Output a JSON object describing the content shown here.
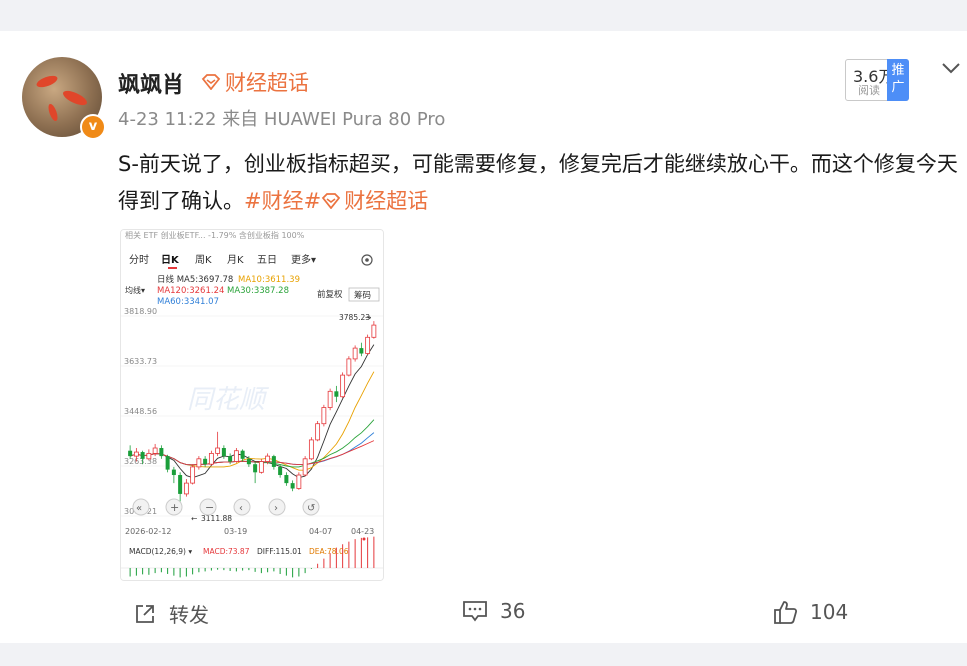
{
  "post": {
    "username": "飒飒肖",
    "topic_tag": "财经超话",
    "time": "4-23 11:22",
    "source": "来自 HUAWEI Pura 80 Pro",
    "reads_count": "3.6万",
    "reads_label": "阅读",
    "promote_label": "推广",
    "text": "S-前天说了，创业板指标超买，可能需要修复，修复完后才能继续放心干。而这个修复今天得到了确认。",
    "hashtag_1": "#财经#",
    "hashtag_2": "财经超话"
  },
  "chart": {
    "topbar": "相关 ETF  创业板ETF...  -1.79%  含创业板指 100%",
    "tabs": [
      "分时",
      "日K",
      "周K",
      "月K",
      "五日",
      "更多▾"
    ],
    "ma_line1_a": "日线 MA5:3697.78",
    "ma_line1_b": "MA10:3611.39",
    "ma_line2_a": "MA120:3261.24",
    "ma_line2_b": "MA30:3387.28",
    "ma_line3": "MA60:3341.07",
    "avg_label": "均线▾",
    "fq_label": "前复权",
    "chip_label": "筹码",
    "y_ticks": [
      "3818.90",
      "3633.73",
      "3448.56",
      "3263.38",
      "3078.21"
    ],
    "last_price": "3785.23",
    "low_price": "3111.88",
    "x_ticks": [
      "2026-02-12",
      "03-19",
      "04-07",
      "04-23"
    ],
    "macd_label": "MACD(12,26,9) ▾",
    "macd_value": "MACD:73.87",
    "diff_value": "DIFF:115.01",
    "dea_value": "DEA:78.06",
    "watermark": "同花顺"
  },
  "chart_data": {
    "type": "candlestick",
    "title": "",
    "xlabel": "",
    "ylabel": "",
    "ylim": [
      3078.21,
      3818.9
    ],
    "candles": [
      [
        3320,
        3300,
        3340,
        3290
      ],
      [
        3300,
        3315,
        3330,
        3280
      ],
      [
        3315,
        3290,
        3320,
        3270
      ],
      [
        3290,
        3310,
        3325,
        3285
      ],
      [
        3310,
        3330,
        3345,
        3300
      ],
      [
        3330,
        3300,
        3340,
        3290
      ],
      [
        3300,
        3250,
        3305,
        3240
      ],
      [
        3250,
        3230,
        3260,
        3200
      ],
      [
        3230,
        3160,
        3240,
        3111.88
      ],
      [
        3160,
        3200,
        3215,
        3150
      ],
      [
        3200,
        3260,
        3270,
        3195
      ],
      [
        3260,
        3290,
        3300,
        3250
      ],
      [
        3290,
        3270,
        3300,
        3260
      ],
      [
        3270,
        3310,
        3320,
        3265
      ],
      [
        3310,
        3330,
        3390,
        3300
      ],
      [
        3330,
        3300,
        3340,
        3290
      ],
      [
        3300,
        3280,
        3310,
        3270
      ],
      [
        3280,
        3320,
        3330,
        3275
      ],
      [
        3320,
        3290,
        3325,
        3280
      ],
      [
        3290,
        3270,
        3300,
        3260
      ],
      [
        3270,
        3240,
        3280,
        3200
      ],
      [
        3240,
        3280,
        3290,
        3235
      ],
      [
        3280,
        3300,
        3310,
        3270
      ],
      [
        3300,
        3260,
        3305,
        3250
      ],
      [
        3260,
        3230,
        3270,
        3220
      ],
      [
        3230,
        3200,
        3240,
        3190
      ],
      [
        3200,
        3180,
        3210,
        3170
      ],
      [
        3180,
        3230,
        3240,
        3175
      ],
      [
        3230,
        3290,
        3300,
        3225
      ],
      [
        3290,
        3360,
        3370,
        3285
      ],
      [
        3360,
        3420,
        3430,
        3355
      ],
      [
        3420,
        3480,
        3490,
        3410
      ],
      [
        3480,
        3540,
        3550,
        3470
      ],
      [
        3540,
        3520,
        3560,
        3500
      ],
      [
        3520,
        3600,
        3610,
        3515
      ],
      [
        3600,
        3660,
        3670,
        3595
      ],
      [
        3660,
        3700,
        3710,
        3650
      ],
      [
        3700,
        3680,
        3720,
        3670
      ],
      [
        3680,
        3740,
        3750,
        3675
      ],
      [
        3740,
        3785.23,
        3800,
        3735
      ]
    ],
    "macd": [
      -20,
      -18,
      -15,
      -16,
      -12,
      -10,
      -14,
      -18,
      -22,
      -20,
      -15,
      -10,
      -8,
      -6,
      -4,
      -5,
      -7,
      -8,
      -6,
      -5,
      -9,
      -12,
      -10,
      -8,
      -14,
      -18,
      -22,
      -20,
      -12,
      -2,
      10,
      22,
      35,
      48,
      56,
      62,
      68,
      71,
      72,
      73.87
    ]
  },
  "actions": {
    "repost_label": "转发",
    "comment_count": "36",
    "like_count": "104"
  },
  "colors": {
    "brand_orange": "#eb7340",
    "promo_blue": "#4d8ef7",
    "up_red": "#e5383b",
    "down_green": "#1a9e3a"
  }
}
